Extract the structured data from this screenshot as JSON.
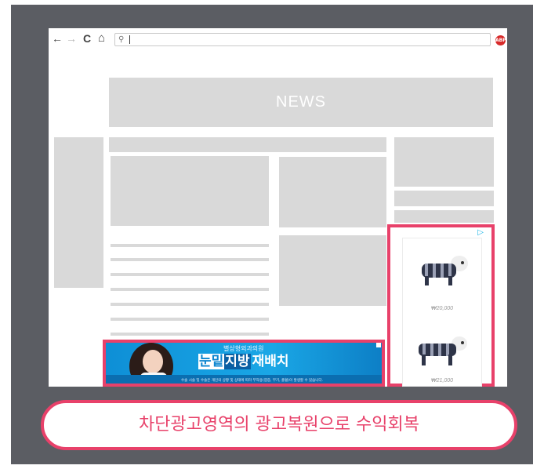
{
  "browser": {
    "back_icon": "←",
    "forward_icon": "→",
    "reload_icon": "C",
    "home_icon": "⌂",
    "search_icon": "⚲",
    "adblock_label": "ABP"
  },
  "page": {
    "news_banner": "NEWS"
  },
  "ads": {
    "bottom": {
      "clinic_name": "별상형외과의원",
      "headline_part1": "눈밑",
      "headline_part2": "지방",
      "headline_part3": "재배치",
      "disclaimer": "수술 시술 및 수술은 개인의 상황 및 상태에 따라 부작용(염증, 부기, 출혈)이 발생할 수 있습니다."
    },
    "side": {
      "adchoices_icon": "▷",
      "price1": "₩20,000",
      "price2": "₩21,000"
    }
  },
  "caption": "차단광고영역의 광고복원으로 수익회복",
  "colors": {
    "frame": "#5b5d63",
    "placeholder": "#d9d9d9",
    "accent": "#e8416a"
  }
}
